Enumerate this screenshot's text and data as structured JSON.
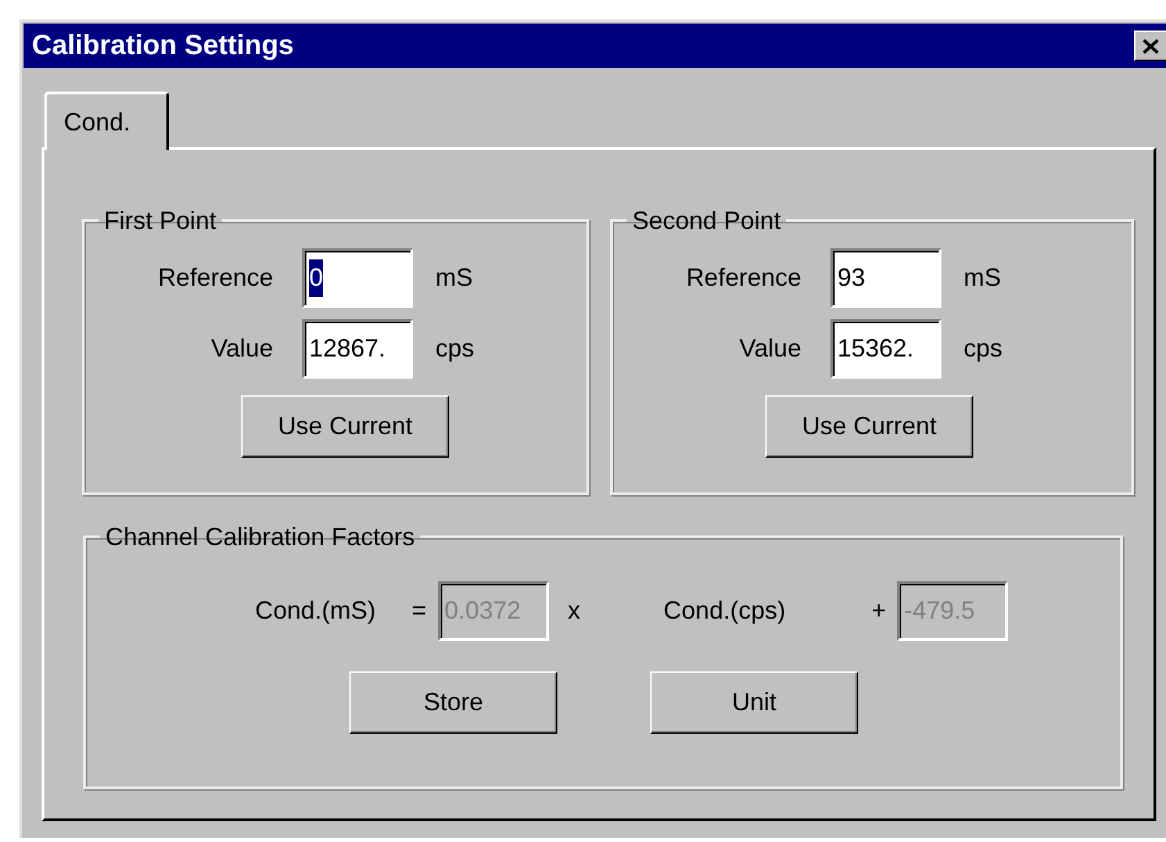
{
  "window": {
    "title": "Calibration Settings"
  },
  "tabs": [
    {
      "label": "Cond.",
      "selected": true
    }
  ],
  "groups": [
    {
      "title": "First Point",
      "fields": [
        {
          "label": "Reference",
          "value": "0",
          "unit": "mS",
          "highlighted": true
        },
        {
          "label": "Value",
          "value": "12867.",
          "unit": "cps",
          "highlighted": false
        }
      ],
      "button": "Use Current"
    },
    {
      "title": "Second Point",
      "fields": [
        {
          "label": "Reference",
          "value": "93",
          "unit": "mS",
          "highlighted": false
        },
        {
          "label": "Value",
          "value": "15362.",
          "unit": "cps",
          "highlighted": false
        }
      ],
      "button": "Use Current"
    }
  ],
  "factors": {
    "title": "Channel Calibration Factors",
    "lhs": "Cond.(mS)",
    "equals": "=",
    "slope": {
      "value": "0.0372",
      "disabled": true
    },
    "times": "x",
    "variable": "Cond.(cps)",
    "plus": "+",
    "offset": {
      "value": "-479.5",
      "disabled": true
    },
    "buttons": [
      "Store",
      "Unit"
    ]
  }
}
